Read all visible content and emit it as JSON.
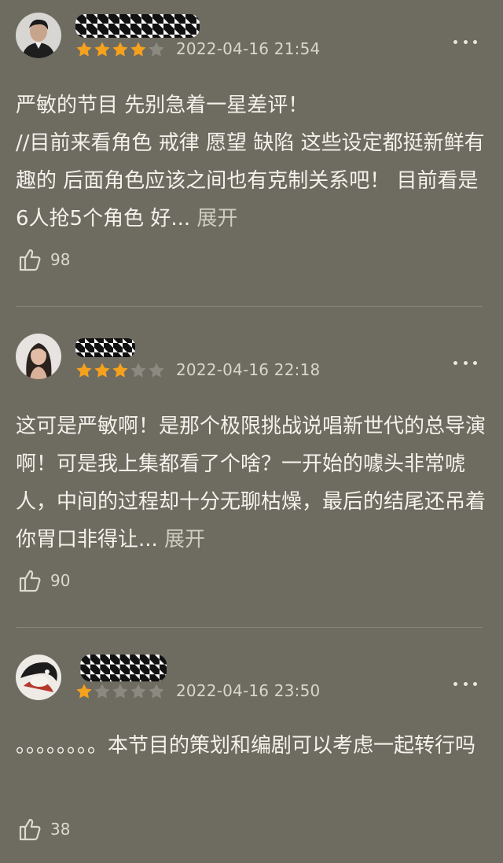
{
  "reviews": [
    {
      "rating": 4,
      "date": "2022-04-16 21:54",
      "text": "严敏的节目 先别急着一星差评！\n//目前来看角色 戒律 愿望 缺陷 这些设定都挺新鲜有趣的 后面角色应该之间也有克制关系吧！ 目前看是6人抢5个角色 好...",
      "expand_label": " 展开",
      "likes": "98"
    },
    {
      "rating": 3,
      "date": "2022-04-16 22:18",
      "text": "这可是严敏啊！是那个极限挑战说唱新世代的总导演啊！可是我上集都看了个啥？一开始的噱头非常唬人，中间的过程却十分无聊枯燥，最后的结尾还吊着你胃口非得让...",
      "expand_label": " 展开",
      "likes": "90"
    },
    {
      "rating": 1,
      "date": "2022-04-16 23:50",
      "text": "。。。。。。。。本节目的策划和编剧可以考虑一起转行吗",
      "likes": "38"
    }
  ],
  "colors": {
    "background": "#6e6b61",
    "star_filled": "#f4a11e",
    "star_empty": "#8c8980"
  },
  "icons": {
    "more": "more-dots-icon",
    "like": "thumbs-up-icon",
    "star": "star-icon"
  }
}
